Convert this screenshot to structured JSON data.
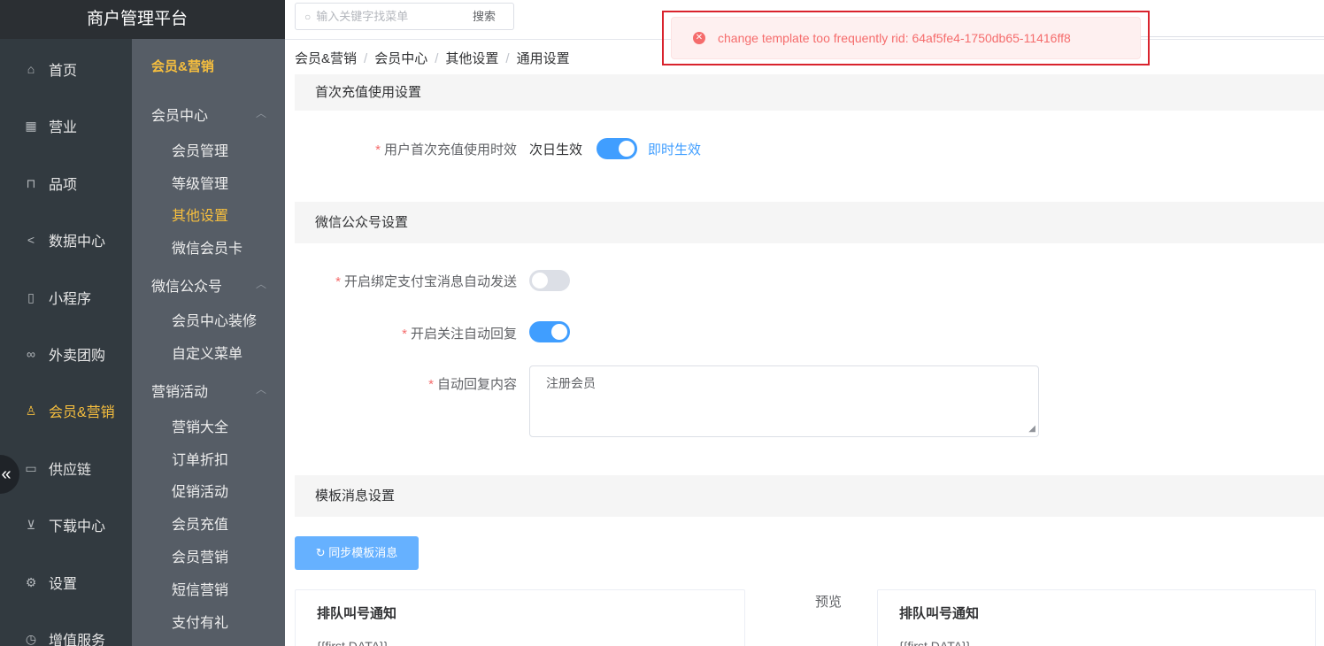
{
  "brand": "商户管理平台",
  "search": {
    "placeholder": "输入关键字找菜单",
    "button": "搜索"
  },
  "sidebar": [
    {
      "label": "首页",
      "icon": "home-icon",
      "glyph": "⌂"
    },
    {
      "label": "营业",
      "icon": "calendar-icon",
      "glyph": "▦"
    },
    {
      "label": "品项",
      "icon": "bag-icon",
      "glyph": "⊓"
    },
    {
      "label": "数据中心",
      "icon": "share-icon",
      "glyph": "<"
    },
    {
      "label": "小程序",
      "icon": "tablet-icon",
      "glyph": "▯"
    },
    {
      "label": "外卖团购",
      "icon": "bike-icon",
      "glyph": "∞"
    },
    {
      "label": "会员&营销",
      "icon": "user-icon",
      "glyph": "♙"
    },
    {
      "label": "供应链",
      "icon": "truck-icon",
      "glyph": "▭"
    },
    {
      "label": "下载中心",
      "icon": "download-icon",
      "glyph": "⊻"
    },
    {
      "label": "设置",
      "icon": "settings-icon",
      "glyph": "⚙"
    },
    {
      "label": "增值服务",
      "icon": "clock-icon",
      "glyph": "◷"
    }
  ],
  "collapse_glyph": "«",
  "submenu": {
    "title": "会员&营销",
    "groups": [
      {
        "label": "会员中心",
        "items": [
          "会员管理",
          "等级管理",
          "其他设置",
          "微信会员卡"
        ]
      },
      {
        "label": "微信公众号",
        "items": [
          "会员中心装修",
          "自定义菜单"
        ]
      },
      {
        "label": "营销活动",
        "items": [
          "营销大全",
          "订单折扣",
          "促销活动",
          "会员充值",
          "会员营销",
          "短信营销",
          "支付有礼"
        ]
      }
    ],
    "active_item": "其他设置"
  },
  "breadcrumb": [
    "会员&营销",
    "会员中心",
    "其他设置",
    "通用设置"
  ],
  "breadcrumb_sep": "/",
  "sections": {
    "first_recharge": "首次充值使用设置",
    "wechat": "微信公众号设置",
    "template": "模板消息设置"
  },
  "form": {
    "recharge_label": "用户首次充值使用时效",
    "recharge_left": "次日生效",
    "recharge_right": "即时生效",
    "alipay_label": "开启绑定支付宝消息自动发送",
    "follow_label": "开启关注自动回复",
    "reply_label": "自动回复内容",
    "reply_value": "注册会员",
    "required_mark": "*"
  },
  "sync_button": "同步模板消息",
  "sync_glyph": "↻",
  "template_card_title": "排队叫号通知",
  "template_card_body": "{{first.DATA}}",
  "preview_label": "预览",
  "preview_card_title": "排队叫号通知",
  "preview_card_body": "{{first.DATA}}",
  "toast": {
    "text": "change template too frequently rid: 64af5fe4-1750db65-11416ff8",
    "glyph": "✕"
  }
}
